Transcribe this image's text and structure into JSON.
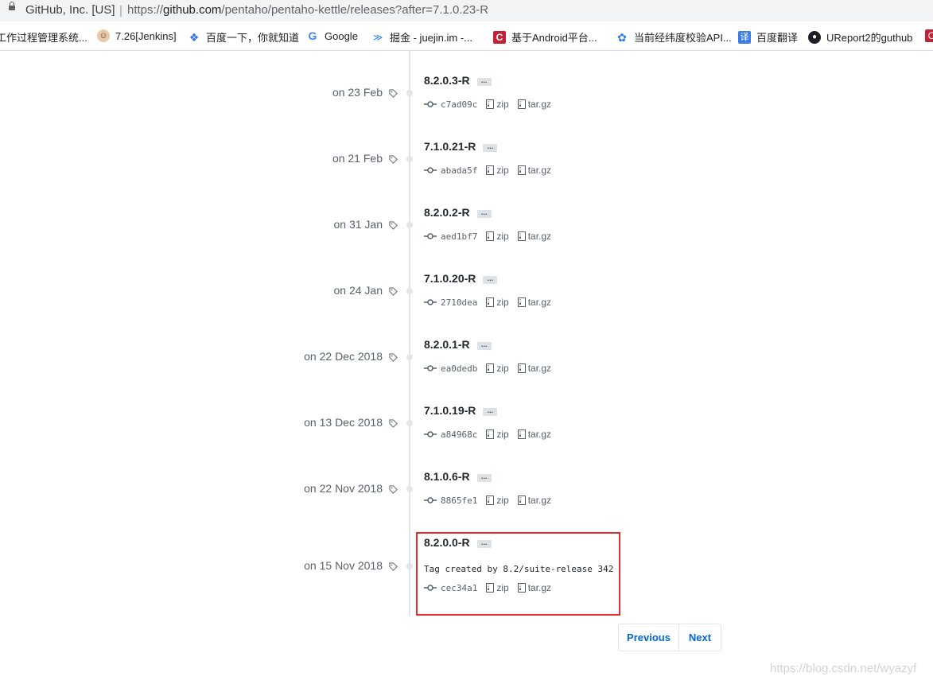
{
  "browser": {
    "site_identity": "GitHub, Inc. [US]",
    "url_prefix": "https://",
    "url_host": "github.com",
    "url_path": "/pentaho/pentaho-kettle/releases?after=7.1.0.23-R"
  },
  "bookmarks": [
    {
      "label": "工作过程管理系统...",
      "icon": "page-icon"
    },
    {
      "label": "7.26[Jenkins]",
      "icon": "jenkins-icon"
    },
    {
      "label": "百度一下，你就知道",
      "icon": "baidu-paw-icon"
    },
    {
      "label": "Google",
      "icon": "google-g-icon"
    },
    {
      "label": "掘金 - juejin.im -...",
      "icon": "juejin-icon"
    },
    {
      "label": "基于Android平台...",
      "icon": "csdn-c-icon"
    },
    {
      "label": "当前经纬度校验API...",
      "icon": "map-api-icon"
    },
    {
      "label": "百度翻译",
      "icon": "translate-icon"
    },
    {
      "label": "UReport2的guthub",
      "icon": "github-octocat-icon"
    }
  ],
  "releases": [
    {
      "date": "on 23 Feb",
      "name": "8.2.0.3-R",
      "commit": "c7ad09c",
      "zip": "zip",
      "targz": "tar.gz"
    },
    {
      "date": "on 21 Feb",
      "name": "7.1.0.21-R",
      "commit": "abada5f",
      "zip": "zip",
      "targz": "tar.gz"
    },
    {
      "date": "on 31 Jan",
      "name": "8.2.0.2-R",
      "commit": "aed1bf7",
      "zip": "zip",
      "targz": "tar.gz"
    },
    {
      "date": "on 24 Jan",
      "name": "7.1.0.20-R",
      "commit": "2710dea",
      "zip": "zip",
      "targz": "tar.gz"
    },
    {
      "date": "on 22 Dec 2018",
      "name": "8.2.0.1-R",
      "commit": "ea0dedb",
      "zip": "zip",
      "targz": "tar.gz"
    },
    {
      "date": "on 13 Dec 2018",
      "name": "7.1.0.19-R",
      "commit": "a84968c",
      "zip": "zip",
      "targz": "tar.gz"
    },
    {
      "date": "on 22 Nov 2018",
      "name": "8.1.0.6-R",
      "commit": "8865fe1",
      "zip": "zip",
      "targz": "tar.gz"
    },
    {
      "date": "on 15 Nov 2018",
      "name": "8.2.0.0-R",
      "commit": "cec34a1",
      "zip": "zip",
      "targz": "tar.gz",
      "message": "Tag created by 8.2/suite-release 342",
      "highlighted": true
    }
  ],
  "more_label": "...",
  "pagination": {
    "previous": "Previous",
    "next": "Next"
  },
  "watermark": "https://blog.csdn.net/wyazyf",
  "colors": {
    "link": "#0366d6",
    "highlight_border": "#e02f2f",
    "timeline": "#e1e4e8"
  }
}
